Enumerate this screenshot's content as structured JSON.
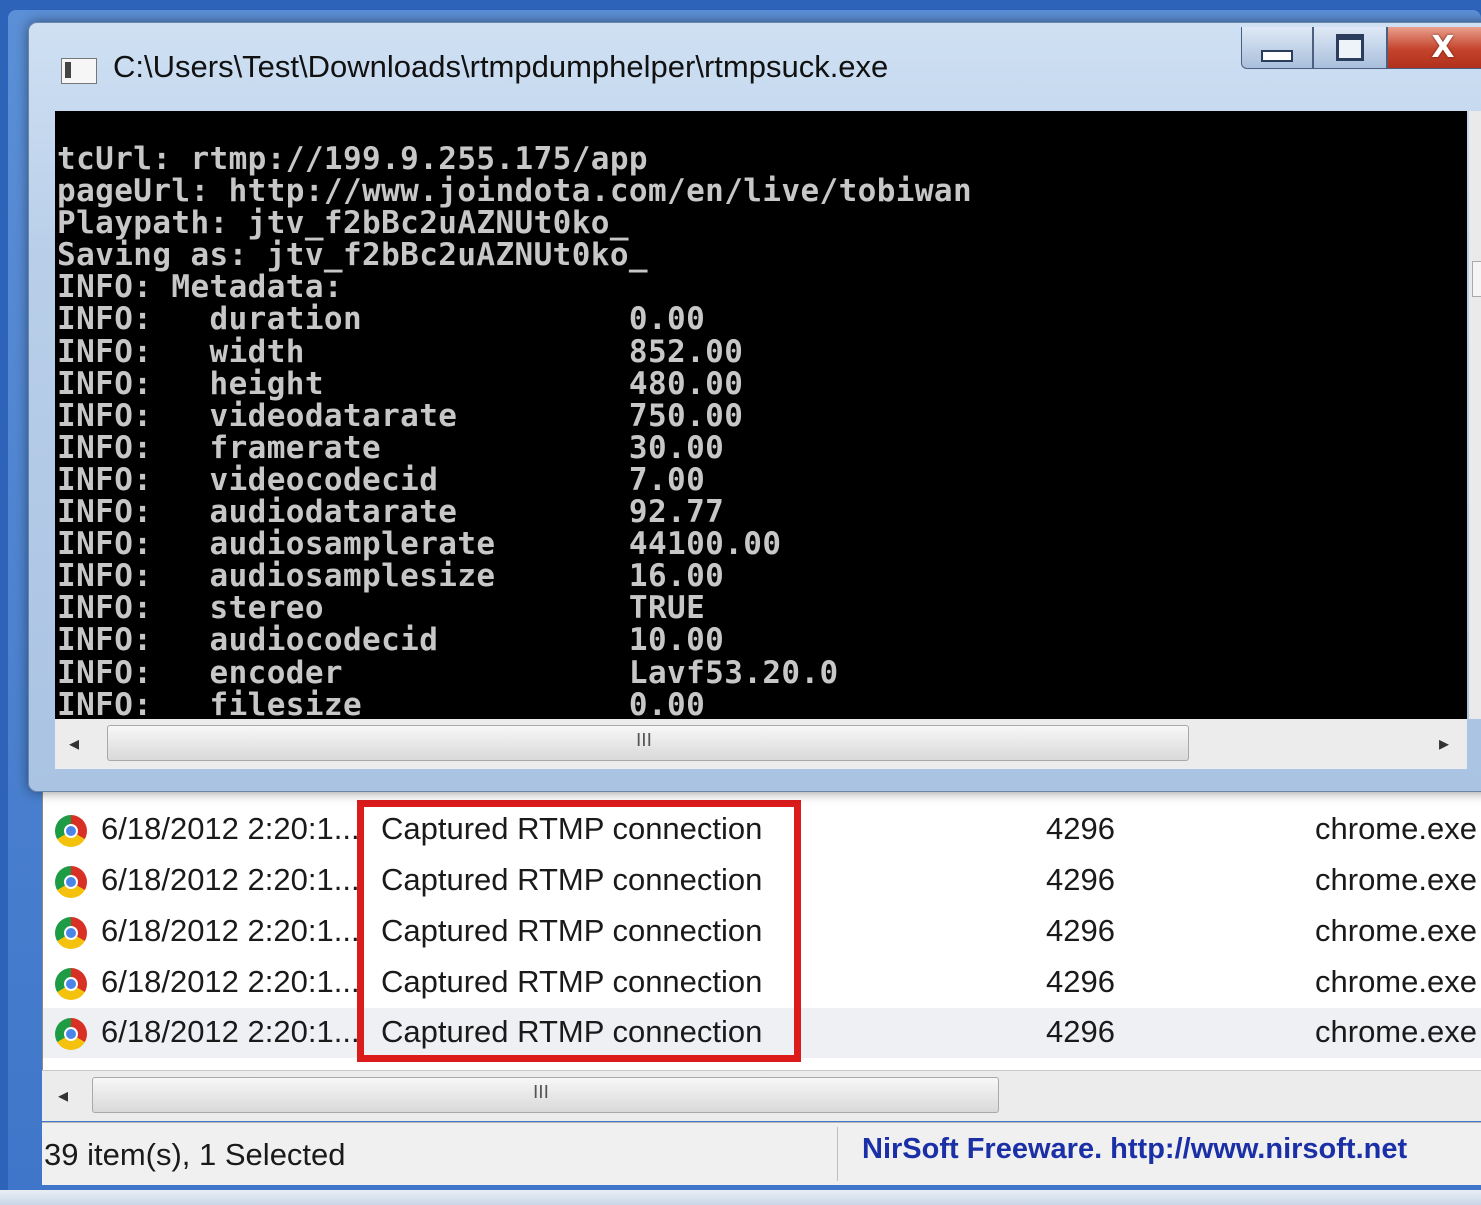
{
  "console_window": {
    "title": "C:\\Users\\Test\\Downloads\\rtmpdumphelper\\rtmpsuck.exe",
    "lines": [
      "tcUrl: rtmp://199.9.255.175/app",
      "pageUrl: http://www.joindota.com/en/live/tobiwan",
      "Playpath: jtv_f2bBc2uAZNUt0ko_",
      "Saving as: jtv_f2bBc2uAZNUt0ko_",
      "INFO: Metadata:",
      "INFO:   duration              0.00",
      "INFO:   width                 852.00",
      "INFO:   height                480.00",
      "INFO:   videodatarate         750.00",
      "INFO:   framerate             30.00",
      "INFO:   videocodecid          7.00",
      "INFO:   audiodatarate         92.77",
      "INFO:   audiosamplerate       44100.00",
      "INFO:   audiosamplesize       16.00",
      "INFO:   stereo                TRUE",
      "INFO:   audiocodecid          10.00",
      "INFO:   encoder               Lavf53.20.0",
      "INFO:   filesize              0.00"
    ],
    "close_glyph": "X",
    "scroll_left": "◂",
    "scroll_right": "▸",
    "scroll_grip": "III"
  },
  "list": {
    "rows": [
      {
        "time": "6/18/2012 2:20:1...",
        "event": "Captured RTMP connection",
        "pid": "4296",
        "process": "chrome.exe"
      },
      {
        "time": "6/18/2012 2:20:1...",
        "event": "Captured RTMP connection",
        "pid": "4296",
        "process": "chrome.exe"
      },
      {
        "time": "6/18/2012 2:20:1...",
        "event": "Captured RTMP connection",
        "pid": "4296",
        "process": "chrome.exe"
      },
      {
        "time": "6/18/2012 2:20:1...",
        "event": "Captured RTMP connection",
        "pid": "4296",
        "process": "chrome.exe"
      },
      {
        "time": "6/18/2012 2:20:1...",
        "event": "Captured RTMP connection",
        "pid": "4296",
        "process": "chrome.exe"
      }
    ],
    "row_icon": "chrome-icon",
    "scroll_left": "◂",
    "scroll_grip": "III"
  },
  "status": {
    "left": "39 item(s), 1 Selected",
    "right": "NirSoft Freeware.  http://www.nirsoft.net"
  },
  "colors": {
    "highlight": "#dc1b1b",
    "link": "#1b2fa6",
    "console_bg": "#000000"
  }
}
